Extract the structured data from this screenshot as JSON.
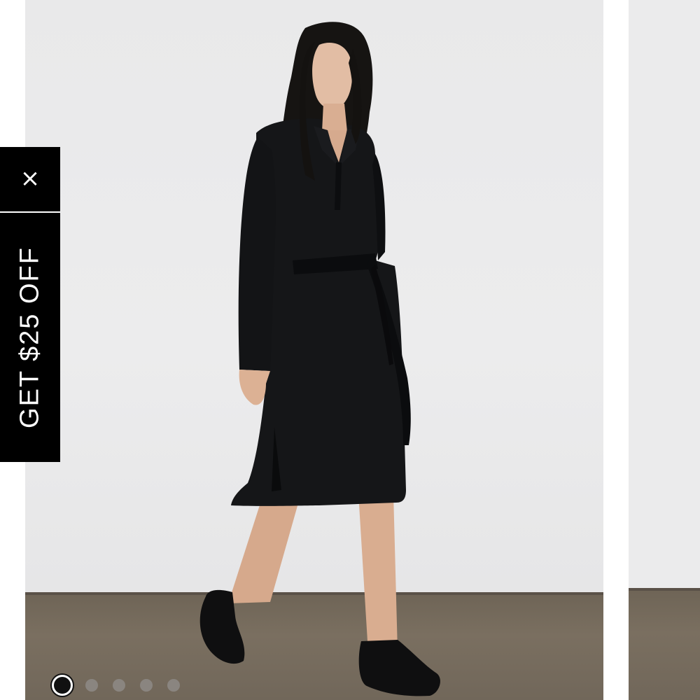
{
  "promo": {
    "close_icon": "close-icon",
    "close_glyph": "×",
    "label": "GET $25 OFF",
    "background_color": "#000000",
    "text_color": "#ffffff"
  },
  "product_image": {
    "description_icon": "product-photo",
    "background_color": "#ebebec",
    "floor_color": "#756b5d",
    "dress_color": "#111214"
  },
  "carousel": {
    "total_slides": 5,
    "active_index": 0
  }
}
